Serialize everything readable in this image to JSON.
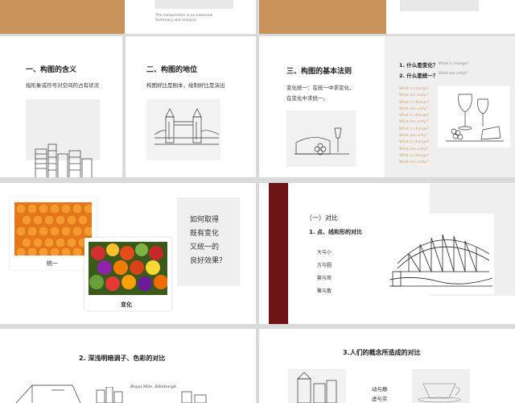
{
  "top": {
    "overview_lines": [
      "The composition is an overview",
      "Summary and analysis"
    ]
  },
  "slide1": {
    "title": "一、构图的含义",
    "body": "指形象或符号对空间的占有状况"
  },
  "slide2": {
    "title": "二、构图的地位",
    "body": "构图好比是剧本，绘制好比是演出"
  },
  "slide3": {
    "title": "三、构图的基本法则",
    "body": [
      "变化统一：在统一中求变化，",
      "在变化中求统一。"
    ]
  },
  "slide4": {
    "q1": "1. 什么是变化？",
    "q1_en": "What is change?",
    "q2": "2. 什么是统一？",
    "q2_en": "What are unity?",
    "list": [
      "What is change?",
      "What are unity?",
      "What is change?",
      "What are unity?",
      "What is change?",
      "What are unity?",
      "What is change?",
      "What are unity?",
      "What is change?",
      "What are unity?",
      "What is change?",
      "What are unity?"
    ]
  },
  "slide5": {
    "caption_unity": "统一",
    "caption_change": "变化",
    "question": [
      "如何取得",
      "既有变化",
      "又统一的",
      "良好效果？"
    ]
  },
  "slide6": {
    "heading": "（一）对比",
    "subheading": "1. 点、线和形的对比",
    "items": [
      "大与小",
      "方与圆",
      "繁与简",
      "聚与散"
    ]
  },
  "slide7": {
    "title": "2. 深浅明暗调子、色彩的对比",
    "sign_text": "Royal Mile, Edinburgh"
  },
  "slide8": {
    "title": "3.人们的概念所造成的对比",
    "pairs": [
      "动与静",
      "虚与实"
    ]
  },
  "colors": {
    "brown": "#c9935c",
    "dark_red": "#6e1414",
    "bg": "#d9dada"
  }
}
